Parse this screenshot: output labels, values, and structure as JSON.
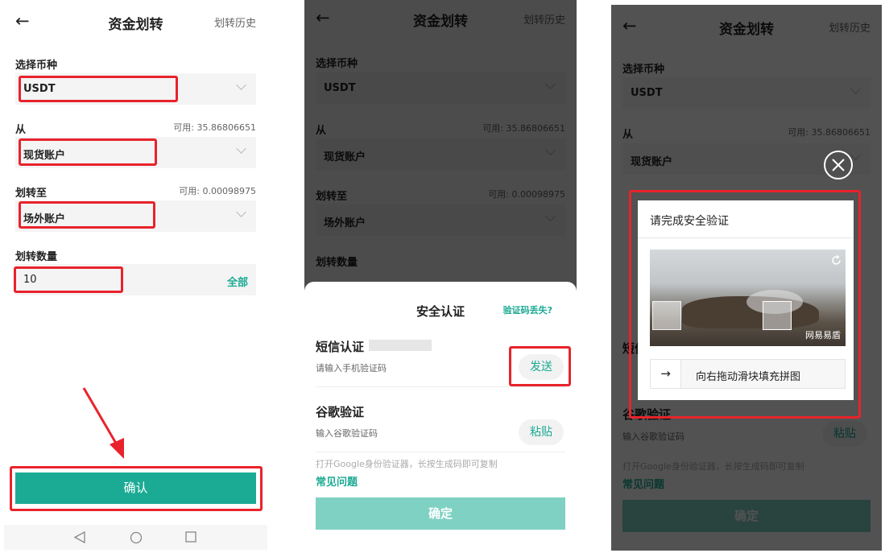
{
  "transfer": {
    "title": "资金划转",
    "history": "划转历史",
    "back_icon": "←",
    "coin_label": "选择币种",
    "coin_value": "USDT",
    "from_label": "从",
    "from_available": "可用: 35.86806651",
    "from_value": "现货账户",
    "to_label": "划转至",
    "to_available": "可用: 0.00098975",
    "to_value": "场外账户",
    "amount_label": "划转数量",
    "amount_value": "10",
    "all_label": "全部",
    "confirm_label": "确认"
  },
  "security": {
    "title": "安全认证",
    "lost_code": "验证码丢失?",
    "sms_label": "短信认证",
    "sms_placeholder": "请输入手机验证码",
    "send_label": "发送",
    "google_label": "谷歌验证",
    "google_placeholder": "输入谷歌验证码",
    "paste_label": "粘贴",
    "google_hint": "打开Google身份验证器，长按生成码即可复制",
    "faq": "常见问题",
    "ok_label": "确定"
  },
  "captcha": {
    "title": "请完成安全验证",
    "brand": "网易易盾",
    "slider_text": "向右拖动滑块填充拼图",
    "arrow": "→"
  },
  "colors": {
    "accent": "#1bab95",
    "highlight": "#e8232b"
  }
}
